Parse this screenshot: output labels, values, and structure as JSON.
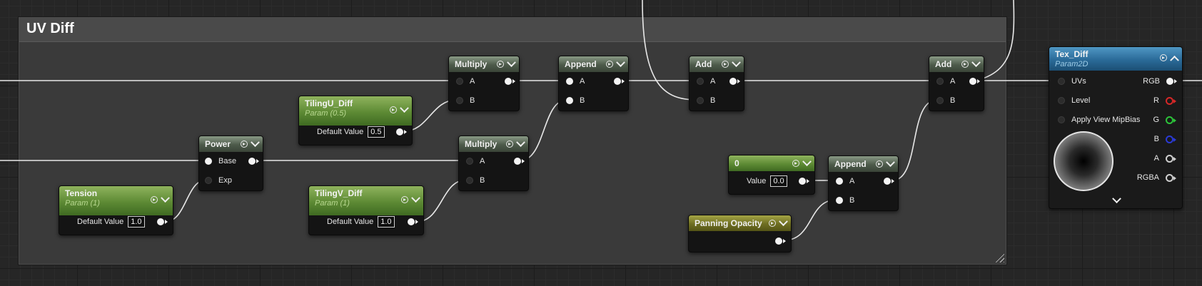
{
  "comment": {
    "title": "UV Diff"
  },
  "nodes": {
    "multiply1": {
      "title": "Multiply",
      "pins": [
        "A",
        "B"
      ]
    },
    "append1": {
      "title": "Append",
      "pins": [
        "A",
        "B"
      ]
    },
    "add1": {
      "title": "Add",
      "pins": [
        "A",
        "B"
      ]
    },
    "add2": {
      "title": "Add",
      "pins": [
        "A",
        "B"
      ]
    },
    "tiling_u": {
      "title": "TilingU_Diff",
      "subtitle": "Param (0.5)",
      "field_label": "Default Value",
      "value": "0.5"
    },
    "power": {
      "title": "Power",
      "pins": [
        "Base",
        "Exp"
      ]
    },
    "multiply2": {
      "title": "Multiply",
      "pins": [
        "A",
        "B"
      ]
    },
    "constant": {
      "title": "0",
      "field_label": "Value",
      "value": "0.0"
    },
    "append2": {
      "title": "Append",
      "pins": [
        "A",
        "B"
      ]
    },
    "tension": {
      "title": "Tension",
      "subtitle": "Param (1)",
      "field_label": "Default Value",
      "value": "1.0"
    },
    "tiling_v": {
      "title": "TilingV_Diff",
      "subtitle": "Param (1)",
      "field_label": "Default Value",
      "value": "1.0"
    },
    "panning": {
      "title": "Panning Opacity"
    },
    "tex_diff": {
      "title": "Tex_Diff",
      "subtitle": "Param2D",
      "inputs": [
        "UVs",
        "Level",
        "Apply View MipBias"
      ],
      "outputs": [
        "RGB",
        "R",
        "G",
        "B",
        "A",
        "RGBA"
      ]
    }
  },
  "colors": {
    "background": "#262626",
    "comment_body": "#3a3a3a",
    "wire": "#e8e8e8",
    "header_math": "#4d5a4a",
    "header_param": "#5d8a34",
    "header_material_fn": "#6e6e22",
    "header_texture": "#2a6a98",
    "channel_r": "#d62828",
    "channel_g": "#2cc43a",
    "channel_b": "#2a3ad6"
  },
  "icons": [
    "preview-toggle-icon",
    "collapse-chevron-icon",
    "expand-chevron-icon",
    "resize-grip-icon"
  ]
}
